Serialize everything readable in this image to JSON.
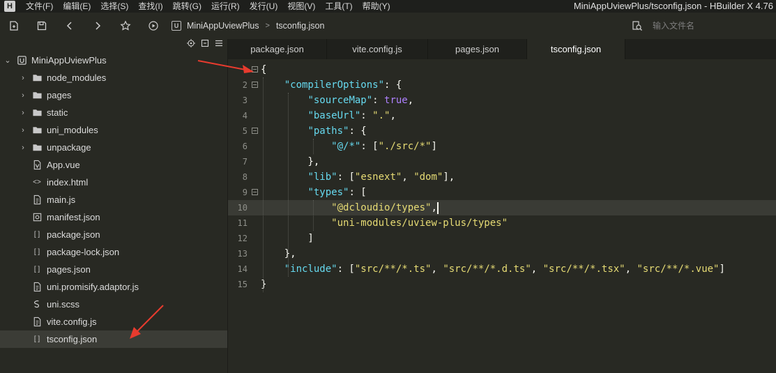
{
  "menubar": {
    "logo": "H",
    "items": [
      "文件(F)",
      "编辑(E)",
      "选择(S)",
      "查找(I)",
      "跳转(G)",
      "运行(R)",
      "发行(U)",
      "视图(V)",
      "工具(T)",
      "帮助(Y)"
    ],
    "window_title": "MiniAppUviewPlus/tsconfig.json - HBuilder X 4.76"
  },
  "toolbar": {
    "icons": [
      "new-file-icon",
      "save-icon",
      "back-icon",
      "forward-icon",
      "star-icon",
      "run-icon"
    ],
    "breadcrumb": [
      "MiniAppUviewPlus",
      "tsconfig.json"
    ],
    "breadcrumb_sep": ">",
    "search_placeholder": "输入文件名"
  },
  "explorer": {
    "project": "MiniAppUviewPlus",
    "items": [
      {
        "label": "node_modules",
        "kind": "folder"
      },
      {
        "label": "pages",
        "kind": "folder"
      },
      {
        "label": "static",
        "kind": "folder"
      },
      {
        "label": "uni_modules",
        "kind": "folder"
      },
      {
        "label": "unpackage",
        "kind": "folder"
      },
      {
        "label": "App.vue",
        "kind": "vue",
        "glyph": "V"
      },
      {
        "label": "index.html",
        "kind": "html",
        "glyph": "<>"
      },
      {
        "label": "main.js",
        "kind": "js"
      },
      {
        "label": "manifest.json",
        "kind": "manifest"
      },
      {
        "label": "package.json",
        "kind": "json",
        "glyph": "[ ]"
      },
      {
        "label": "package-lock.json",
        "kind": "json",
        "glyph": "[ ]"
      },
      {
        "label": "pages.json",
        "kind": "json",
        "glyph": "[ ]"
      },
      {
        "label": "uni.promisify.adaptor.js",
        "kind": "js"
      },
      {
        "label": "uni.scss",
        "kind": "scss"
      },
      {
        "label": "vite.config.js",
        "kind": "js"
      },
      {
        "label": "tsconfig.json",
        "kind": "json",
        "glyph": "[ ]",
        "selected": true
      }
    ]
  },
  "tabs": [
    {
      "label": "package.json",
      "active": false
    },
    {
      "label": "vite.config.js",
      "active": false
    },
    {
      "label": "pages.json",
      "active": false
    },
    {
      "label": "tsconfig.json",
      "active": true
    }
  ],
  "editor": {
    "current_line": 10,
    "lines": [
      {
        "n": "",
        "fold": true,
        "tokens": [
          [
            "p",
            "{"
          ]
        ]
      },
      {
        "n": "2",
        "fold": true,
        "tokens": [
          [
            "p",
            "    "
          ],
          [
            "k",
            "\"compilerOptions\""
          ],
          [
            "p",
            ": {"
          ]
        ]
      },
      {
        "n": "3",
        "fold": false,
        "tokens": [
          [
            "p",
            "        "
          ],
          [
            "k",
            "\"sourceMap\""
          ],
          [
            "p",
            ": "
          ],
          [
            "b",
            "true"
          ],
          [
            "p",
            ","
          ]
        ]
      },
      {
        "n": "4",
        "fold": false,
        "tokens": [
          [
            "p",
            "        "
          ],
          [
            "k",
            "\"baseUrl\""
          ],
          [
            "p",
            ": "
          ],
          [
            "s",
            "\".\""
          ],
          [
            "p",
            ","
          ]
        ]
      },
      {
        "n": "5",
        "fold": true,
        "tokens": [
          [
            "p",
            "        "
          ],
          [
            "k",
            "\"paths\""
          ],
          [
            "p",
            ": {"
          ]
        ]
      },
      {
        "n": "6",
        "fold": false,
        "tokens": [
          [
            "p",
            "            "
          ],
          [
            "k",
            "\"@/*\""
          ],
          [
            "p",
            ": ["
          ],
          [
            "s",
            "\"./src/*\""
          ],
          [
            "p",
            "]"
          ]
        ]
      },
      {
        "n": "7",
        "fold": false,
        "tokens": [
          [
            "p",
            "        },"
          ]
        ]
      },
      {
        "n": "8",
        "fold": false,
        "tokens": [
          [
            "p",
            "        "
          ],
          [
            "k",
            "\"lib\""
          ],
          [
            "p",
            ": ["
          ],
          [
            "s",
            "\"esnext\""
          ],
          [
            "p",
            ", "
          ],
          [
            "s",
            "\"dom\""
          ],
          [
            "p",
            "],"
          ]
        ]
      },
      {
        "n": "9",
        "fold": true,
        "tokens": [
          [
            "p",
            "        "
          ],
          [
            "k",
            "\"types\""
          ],
          [
            "p",
            ": ["
          ]
        ]
      },
      {
        "n": "10",
        "fold": false,
        "tokens": [
          [
            "p",
            "            "
          ],
          [
            "s",
            "\"@dcloudio/types\""
          ],
          [
            "p",
            ","
          ]
        ]
      },
      {
        "n": "11",
        "fold": false,
        "tokens": [
          [
            "p",
            "            "
          ],
          [
            "s",
            "\"uni-modules/uview-plus/types\""
          ]
        ]
      },
      {
        "n": "12",
        "fold": false,
        "tokens": [
          [
            "p",
            "        ]"
          ]
        ]
      },
      {
        "n": "13",
        "fold": false,
        "tokens": [
          [
            "p",
            "    },"
          ]
        ]
      },
      {
        "n": "14",
        "fold": false,
        "tokens": [
          [
            "p",
            "    "
          ],
          [
            "k",
            "\"include\""
          ],
          [
            "p",
            ": ["
          ],
          [
            "s",
            "\"src/**/*.ts\""
          ],
          [
            "p",
            ", "
          ],
          [
            "s",
            "\"src/**/*.d.ts\""
          ],
          [
            "p",
            ", "
          ],
          [
            "s",
            "\"src/**/*.tsx\""
          ],
          [
            "p",
            ", "
          ],
          [
            "s",
            "\"src/**/*.vue\""
          ],
          [
            "p",
            "]"
          ]
        ]
      },
      {
        "n": "15",
        "fold": false,
        "tokens": [
          [
            "p",
            "}"
          ]
        ]
      }
    ]
  },
  "colors": {
    "background": "#282923",
    "key": "#66d9ef",
    "string": "#e6db74",
    "boolean": "#ae81ff",
    "annotation_arrow": "#e83b2e"
  }
}
